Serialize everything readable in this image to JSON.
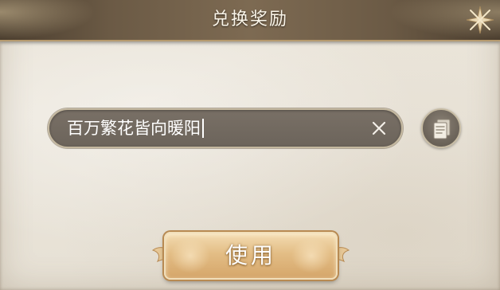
{
  "dialog": {
    "title": "兑换奖励"
  },
  "code_input": {
    "value": "百万繁花皆向暖阳"
  },
  "actions": {
    "use_label": "使用"
  },
  "icons": {
    "close": "close-star-icon",
    "clear": "clear-x-icon",
    "paste": "clipboard-icon"
  },
  "colors": {
    "header": "#6b5a45",
    "paper": "#ece7dd",
    "input_bg": "#736b61",
    "button_gold": "#e3bd85"
  }
}
